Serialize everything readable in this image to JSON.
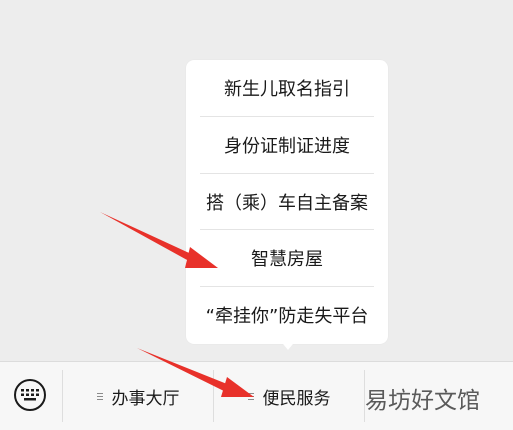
{
  "popup_menu": {
    "items": [
      {
        "label": "新生儿取名指引"
      },
      {
        "label": "身份证制证进度"
      },
      {
        "label": "搭（乘）车自主备案"
      },
      {
        "label": "智慧房屋"
      },
      {
        "label": "“牵挂你”防走失平台"
      }
    ]
  },
  "bottom_bar": {
    "keyboard_icon": "keyboard-icon",
    "tabs": [
      {
        "label": "办事大厅",
        "icon": "menu-lines-icon"
      },
      {
        "label": "便民服务",
        "icon": "menu-lines-icon"
      },
      {
        "label": "",
        "icon": ""
      }
    ]
  },
  "watermark": {
    "text": "易坊好文馆"
  },
  "annotations": {
    "arrow_color": "#e8312a"
  }
}
